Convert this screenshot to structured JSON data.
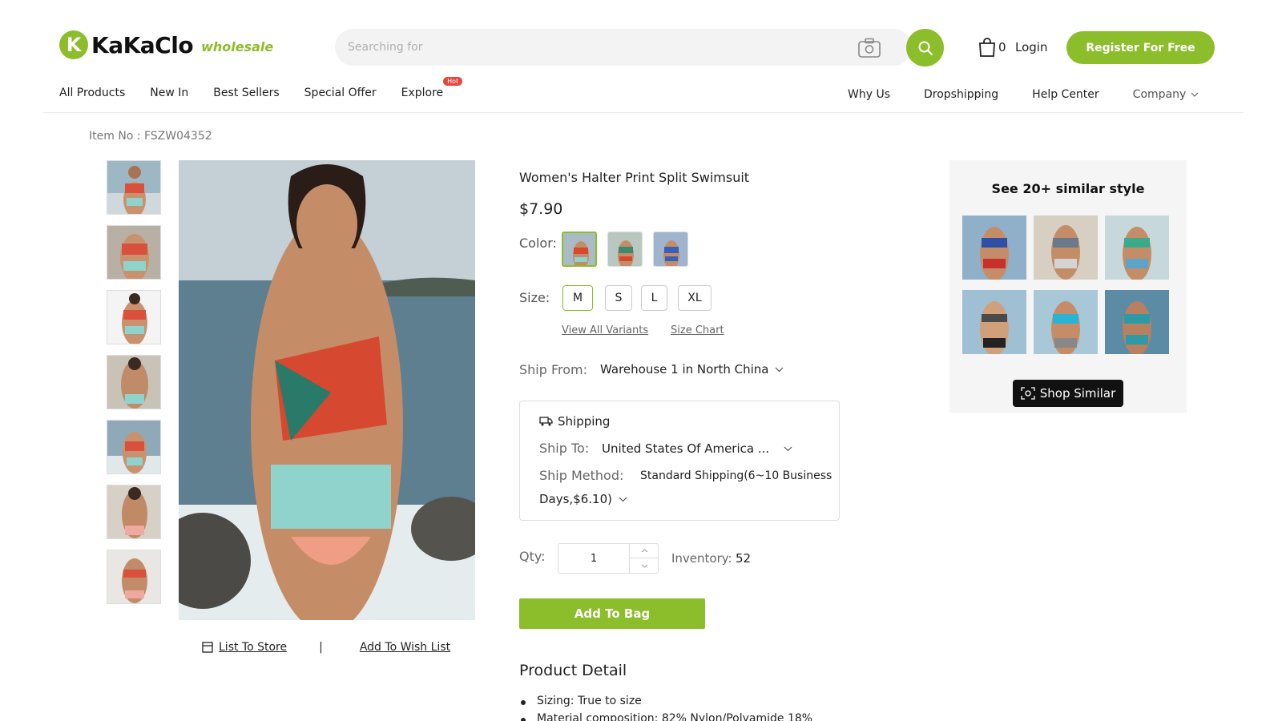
{
  "header": {
    "logo_letter": "K",
    "logo_text": "KaKaClo",
    "logo_sub": "wholesale",
    "search_placeholder": "Searching for",
    "bag_count": "0",
    "login": "Login",
    "register": "Register For Free",
    "accent_color": "#8cbd2a"
  },
  "nav": {
    "left": [
      "All Products",
      "New In",
      "Best Sellers",
      "Special Offer",
      "Explore"
    ],
    "hot_badge": "Hot",
    "right": [
      "Why Us",
      "Dropshipping",
      "Help Center",
      "Company"
    ]
  },
  "product": {
    "item_no": "Item No : FSZW04352",
    "title": "Women's Halter Print Split Swimsuit",
    "price": "$7.90",
    "color_label": "Color:",
    "size_label": "Size:",
    "sizes": [
      "M",
      "S",
      "L",
      "XL"
    ],
    "selected_size": "M",
    "view_variants": "View All Variants",
    "size_chart": "Size Chart",
    "ship_from_label": "Ship From:",
    "ship_from_value": "Warehouse 1 in North China",
    "shipping_title": "Shipping",
    "ship_to_label": "Ship To:",
    "ship_to_value": "United States Of America ...",
    "ship_method_label": "Ship Method:",
    "ship_method_value_1": "Standard Shipping(6~10 Business",
    "ship_method_value_2": "Days,$6.10)",
    "qty_label": "Qty:",
    "qty_value": "1",
    "inventory_label": "Inventory:",
    "inventory_value": "52",
    "add_to_bag": "Add To Bag",
    "list_to_store": "List To Store",
    "separator": "|",
    "add_to_wish": "Add To Wish List",
    "detail_title": "Product Detail",
    "details": [
      "Sizing: True to size",
      "Material composition: 82% Nylon/Polyamide 18%"
    ]
  },
  "similar": {
    "title": "See 20+ similar style",
    "button": "Shop Similar"
  }
}
